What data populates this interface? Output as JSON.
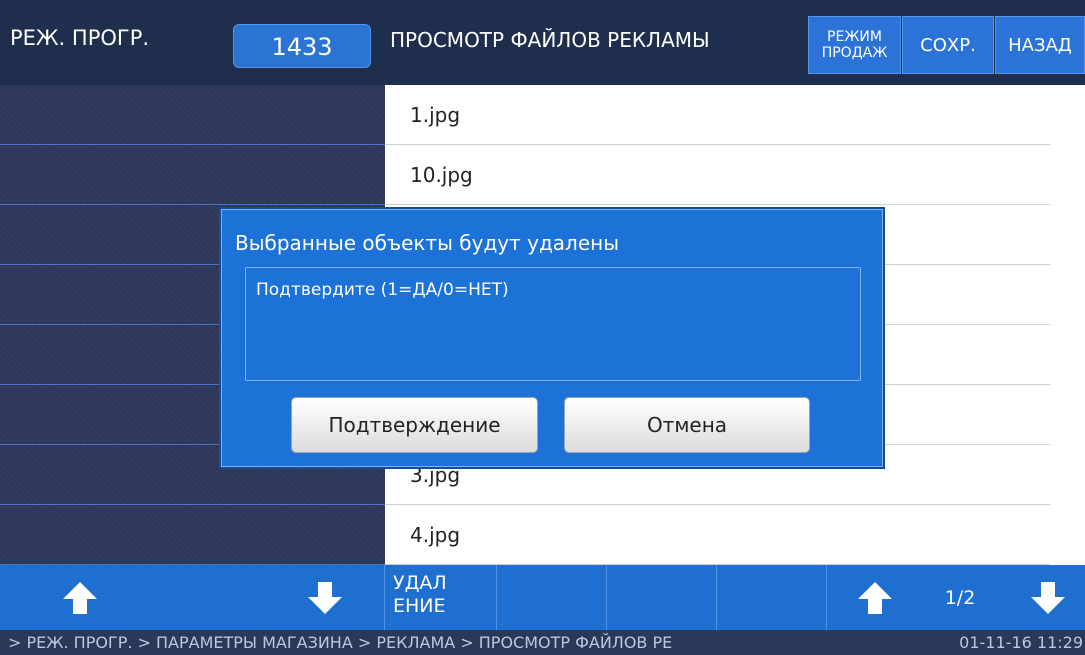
{
  "header": {
    "mode_title": "РЕЖ. ПРОГР.",
    "code": "1433",
    "screen_title": "ПРОСМОТР ФАЙЛОВ РЕКЛАМЫ",
    "sales_mode_line1": "РЕЖИМ",
    "sales_mode_line2": "ПРОДАЖ",
    "save_label": "СОХР.",
    "back_label": "НАЗАД"
  },
  "files": [
    {
      "name": "1.jpg"
    },
    {
      "name": "10.jpg"
    },
    {
      "name": ""
    },
    {
      "name": ""
    },
    {
      "name": ""
    },
    {
      "name": ""
    },
    {
      "name": "3.jpg"
    },
    {
      "name": "4.jpg"
    }
  ],
  "toolbar": {
    "delete_line1": "УДАЛ",
    "delete_line2": "ЕНИЕ",
    "page": "1/2"
  },
  "status": {
    "path": "> РЕЖ. ПРОГР. > ПАРАМЕТРЫ МАГАЗИНА > РЕКЛАМА > ПРОСМОТР ФАЙЛОВ РЕ",
    "datetime": "01-11-16  11:29"
  },
  "dialog": {
    "title": "Выбранные объекты будут удалены",
    "message": "Подтвердите (1=ДА/0=НЕТ)",
    "confirm_label": "Подтверждение",
    "cancel_label": "Отмена"
  },
  "colors": {
    "accent": "#1e6fd0",
    "header_bg": "#1f2e4c",
    "dialog_bg": "#1d72d7"
  }
}
